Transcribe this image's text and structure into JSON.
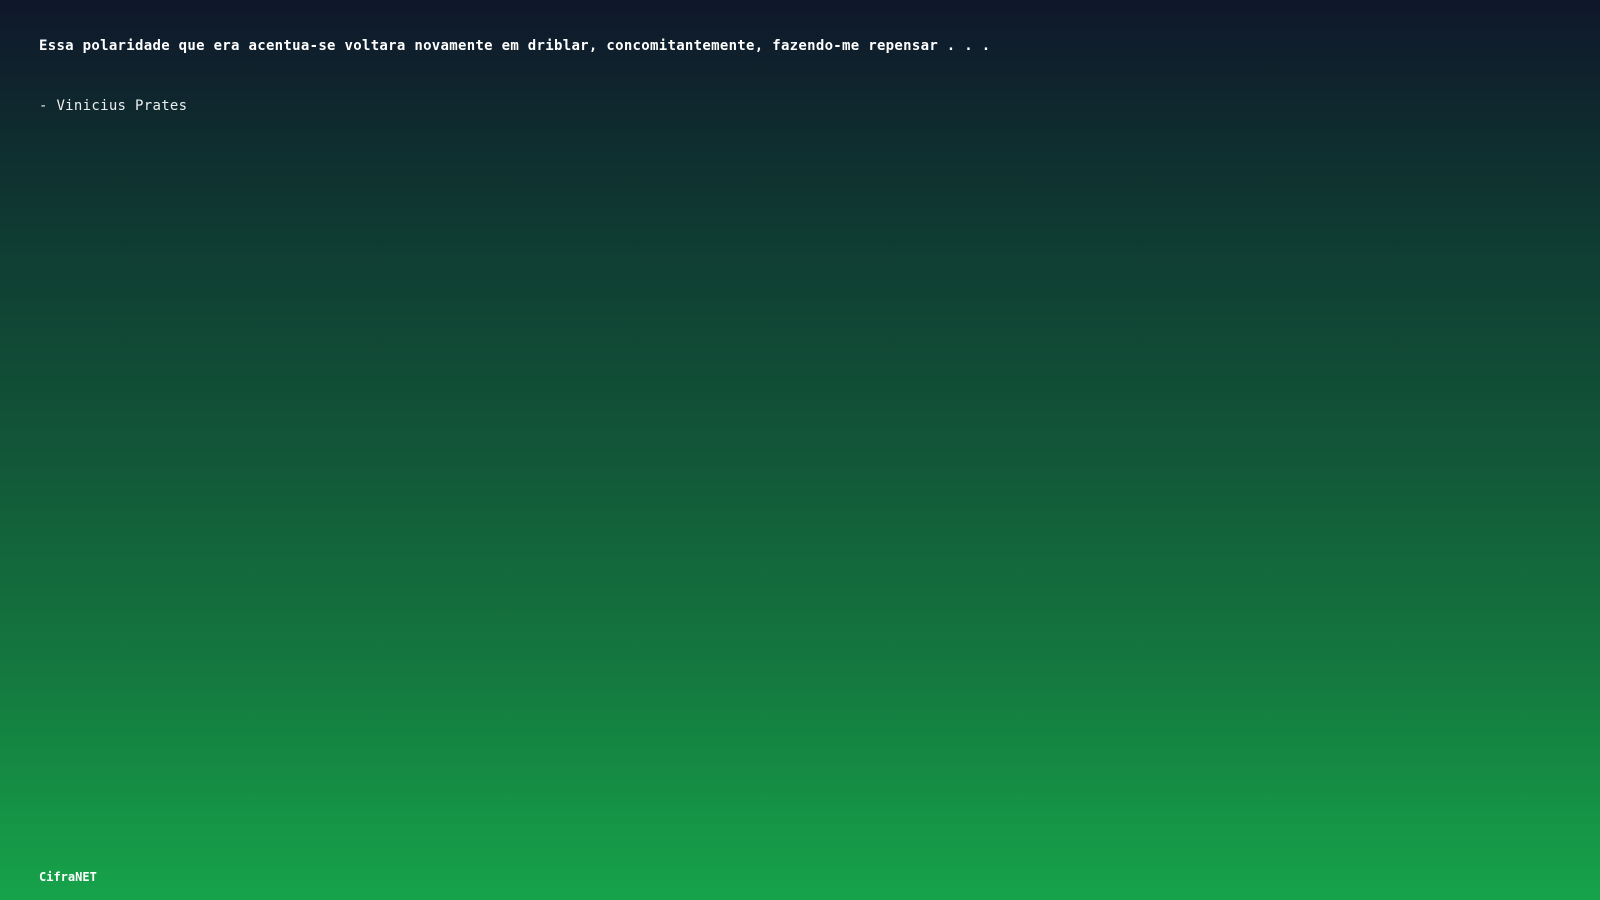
{
  "quote": {
    "text": "Essa polaridade que era acentua-se voltara novamente em driblar, concomitantemente, fazendo-me repensar . . .",
    "author": "- Vinicius Prates"
  },
  "footer": {
    "brand": "CifraNET"
  },
  "colors": {
    "gradient_top": "#0f172a",
    "gradient_bottom": "#16a34a",
    "text": "#ffffff"
  }
}
